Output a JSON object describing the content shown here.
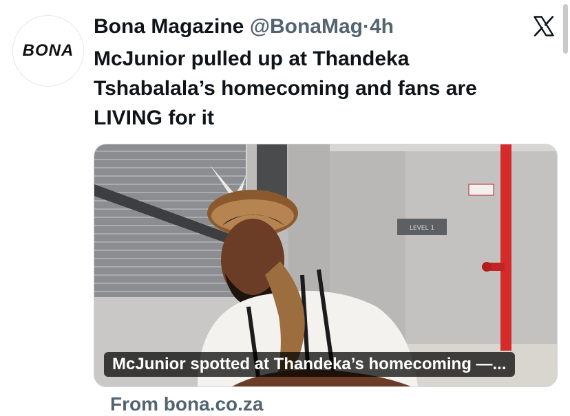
{
  "account": {
    "avatar_text": "BONA",
    "name": "Bona Magazine",
    "handle": "@BonaMag",
    "separator": "·",
    "time": "4h"
  },
  "tweet": {
    "lines": [
      "McJunior pulled up at Thandeka",
      "Tshabalala’s homecoming and fans are",
      "LIVING for it"
    ]
  },
  "card": {
    "image_label": "man-in-traditional-headdress-photo",
    "wall_sign": "LEVEL 1",
    "caption": "McJunior spotted at Thandeka’s homecoming —...",
    "source": "From bona.co.za"
  },
  "icons": {
    "platform": "x-logo-icon"
  },
  "colors": {
    "text_primary": "#0f1419",
    "text_secondary": "#536471",
    "caption_bg": "#000000",
    "pipe_red": "#d62b2b"
  }
}
